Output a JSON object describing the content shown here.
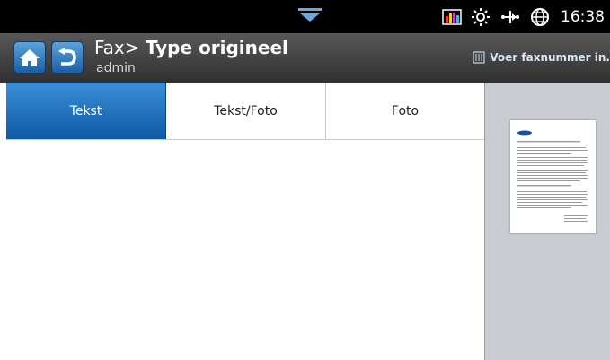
{
  "status_bar": {
    "time": "16:38",
    "icons": [
      "pull-down-handle-icon",
      "toner-level-icon",
      "brightness-icon",
      "network-connection-icon",
      "globe-icon"
    ]
  },
  "header": {
    "title_prefix": "Fax> ",
    "title": "Type origineel",
    "user": "admin",
    "fax_hint": "Voer faxnummer in.",
    "buttons": [
      "home-icon",
      "back-icon"
    ]
  },
  "tabs": [
    {
      "label": "Tekst",
      "selected": true
    },
    {
      "label": "Tekst/Foto",
      "selected": false
    },
    {
      "label": "Foto",
      "selected": false
    }
  ],
  "colors": {
    "accent": "#1a6ec0",
    "header_bg": "#3c3c3c",
    "preview_bg": "#c9cdd2"
  }
}
